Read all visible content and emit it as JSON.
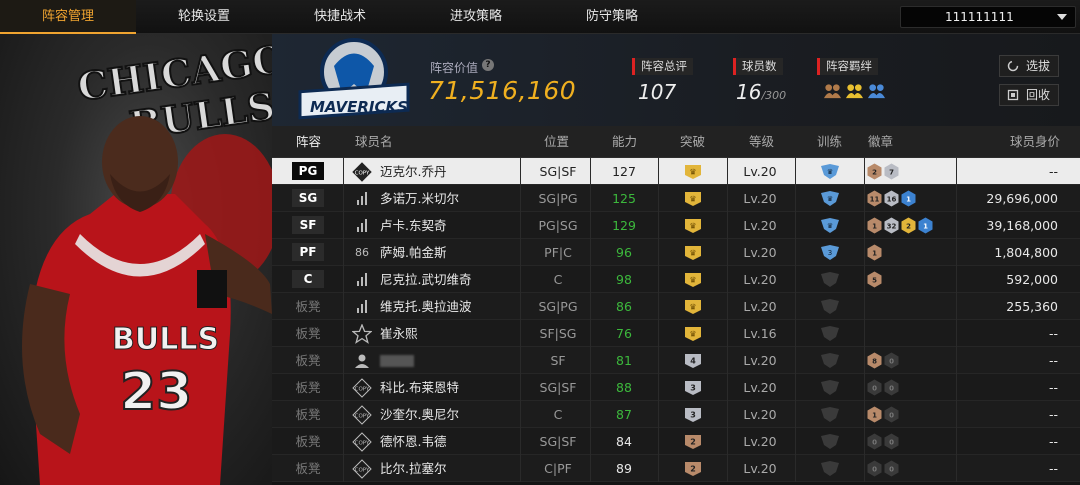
{
  "nav": {
    "tabs": [
      {
        "label": "阵容管理",
        "active": true
      },
      {
        "label": "轮换设置",
        "active": false
      },
      {
        "label": "快捷战术",
        "active": false
      },
      {
        "label": "进攻策略",
        "active": false
      },
      {
        "label": "防守策略",
        "active": false
      }
    ],
    "account": "111111111"
  },
  "hero": {
    "jersey_text": "BULLS",
    "jersey_number": "23",
    "background_text": "CHICAGO BULLS"
  },
  "summary": {
    "team_logo_text": "MAVERICKS",
    "value_label": "阵容价值",
    "value": "71,516,160",
    "rating_label": "阵容总评",
    "rating": "107",
    "players_label": "球员数",
    "players": "16",
    "players_max": "/300",
    "synergy_label": "阵容羁绊",
    "buttons": {
      "scout": "选拔",
      "recycle": "回收"
    }
  },
  "table": {
    "headers": [
      "阵容",
      "球员名",
      "位置",
      "能力",
      "突破",
      "等级",
      "训练",
      "徽章",
      "球员身价"
    ],
    "rows": [
      {
        "slot": "PG",
        "starter": true,
        "type": "COPY",
        "name": "迈克尔.乔丹",
        "pos": "SG|SF",
        "ability": "127",
        "ability_green": false,
        "break": "gold",
        "level": "Lv.20",
        "train": "blue",
        "badges": [
          [
            "bronze",
            "2"
          ],
          [
            "silver",
            "7"
          ]
        ],
        "worth": "--",
        "selected": true
      },
      {
        "slot": "SG",
        "starter": true,
        "type": "bars",
        "name": "多诺万.米切尔",
        "pos": "SG|PG",
        "ability": "125",
        "ability_green": true,
        "break": "gold",
        "level": "Lv.20",
        "train": "blue",
        "badges": [
          [
            "bronze",
            "11"
          ],
          [
            "silver",
            "16"
          ],
          [
            "blue",
            "1"
          ]
        ],
        "worth": "29,696,000",
        "selected": false
      },
      {
        "slot": "SF",
        "starter": true,
        "type": "bars",
        "name": "卢卡.东契奇",
        "pos": "PG|SG",
        "ability": "129",
        "ability_green": true,
        "break": "gold",
        "level": "Lv.20",
        "train": "blue",
        "badges": [
          [
            "bronze",
            "1"
          ],
          [
            "silver",
            "32"
          ],
          [
            "gold",
            "2"
          ],
          [
            "blue",
            "1"
          ]
        ],
        "worth": "39,168,000",
        "selected": false
      },
      {
        "slot": "PF",
        "starter": true,
        "type": "86",
        "name": "萨姆.帕金斯",
        "pos": "PF|C",
        "ability": "96",
        "ability_green": true,
        "break": "gold",
        "level": "Lv.20",
        "train": "blue3",
        "badges": [
          [
            "bronze",
            "1"
          ]
        ],
        "worth": "1,804,800",
        "selected": false
      },
      {
        "slot": "C",
        "starter": true,
        "type": "bars",
        "name": "尼克拉.武切维奇",
        "pos": "C",
        "ability": "98",
        "ability_green": true,
        "break": "gold",
        "level": "Lv.20",
        "train": "dark",
        "badges": [
          [
            "bronze",
            "5"
          ]
        ],
        "worth": "592,000",
        "selected": false
      },
      {
        "slot": "板凳",
        "starter": false,
        "type": "bars",
        "name": "维克托.奥拉迪波",
        "pos": "SG|PG",
        "ability": "86",
        "ability_green": true,
        "break": "gold",
        "level": "Lv.20",
        "train": "dark",
        "badges": [],
        "worth": "255,360",
        "selected": false
      },
      {
        "slot": "板凳",
        "starter": false,
        "type": "star",
        "name": "崔永熙",
        "pos": "SF|SG",
        "ability": "76",
        "ability_green": true,
        "break": "gold",
        "level": "Lv.16",
        "train": "dark",
        "badges": [],
        "worth": "--",
        "selected": false
      },
      {
        "slot": "板凳",
        "starter": false,
        "type": "person",
        "name": "",
        "pos": "SF",
        "ability": "81",
        "ability_green": true,
        "break": "silver4",
        "level": "Lv.20",
        "train": "dark",
        "badges": [
          [
            "bronze",
            "8"
          ],
          [
            "dark",
            "0"
          ]
        ],
        "worth": "--",
        "selected": false
      },
      {
        "slot": "板凳",
        "starter": false,
        "type": "COPY",
        "name": "科比.布莱恩特",
        "pos": "SG|SF",
        "ability": "88",
        "ability_green": true,
        "break": "silver3",
        "level": "Lv.20",
        "train": "dark",
        "badges": [
          [
            "dark",
            "0"
          ],
          [
            "dark",
            "0"
          ]
        ],
        "worth": "--",
        "selected": false
      },
      {
        "slot": "板凳",
        "starter": false,
        "type": "COPY",
        "name": "沙奎尔.奥尼尔",
        "pos": "C",
        "ability": "87",
        "ability_green": true,
        "break": "silver3",
        "level": "Lv.20",
        "train": "dark",
        "badges": [
          [
            "bronze",
            "1"
          ],
          [
            "dark",
            "0"
          ]
        ],
        "worth": "--",
        "selected": false
      },
      {
        "slot": "板凳",
        "starter": false,
        "type": "COPY",
        "name": "德怀恩.韦德",
        "pos": "SG|SF",
        "ability": "84",
        "ability_green": false,
        "break": "bronze2",
        "level": "Lv.20",
        "train": "dark",
        "badges": [
          [
            "dark",
            "0"
          ],
          [
            "dark",
            "0"
          ]
        ],
        "worth": "--",
        "selected": false
      },
      {
        "slot": "板凳",
        "starter": false,
        "type": "COPY",
        "name": "比尔.拉塞尔",
        "pos": "C|PF",
        "ability": "89",
        "ability_green": false,
        "break": "bronze2",
        "level": "Lv.20",
        "train": "dark",
        "badges": [
          [
            "dark",
            "0"
          ],
          [
            "dark",
            "0"
          ]
        ],
        "worth": "--",
        "selected": false
      }
    ]
  }
}
